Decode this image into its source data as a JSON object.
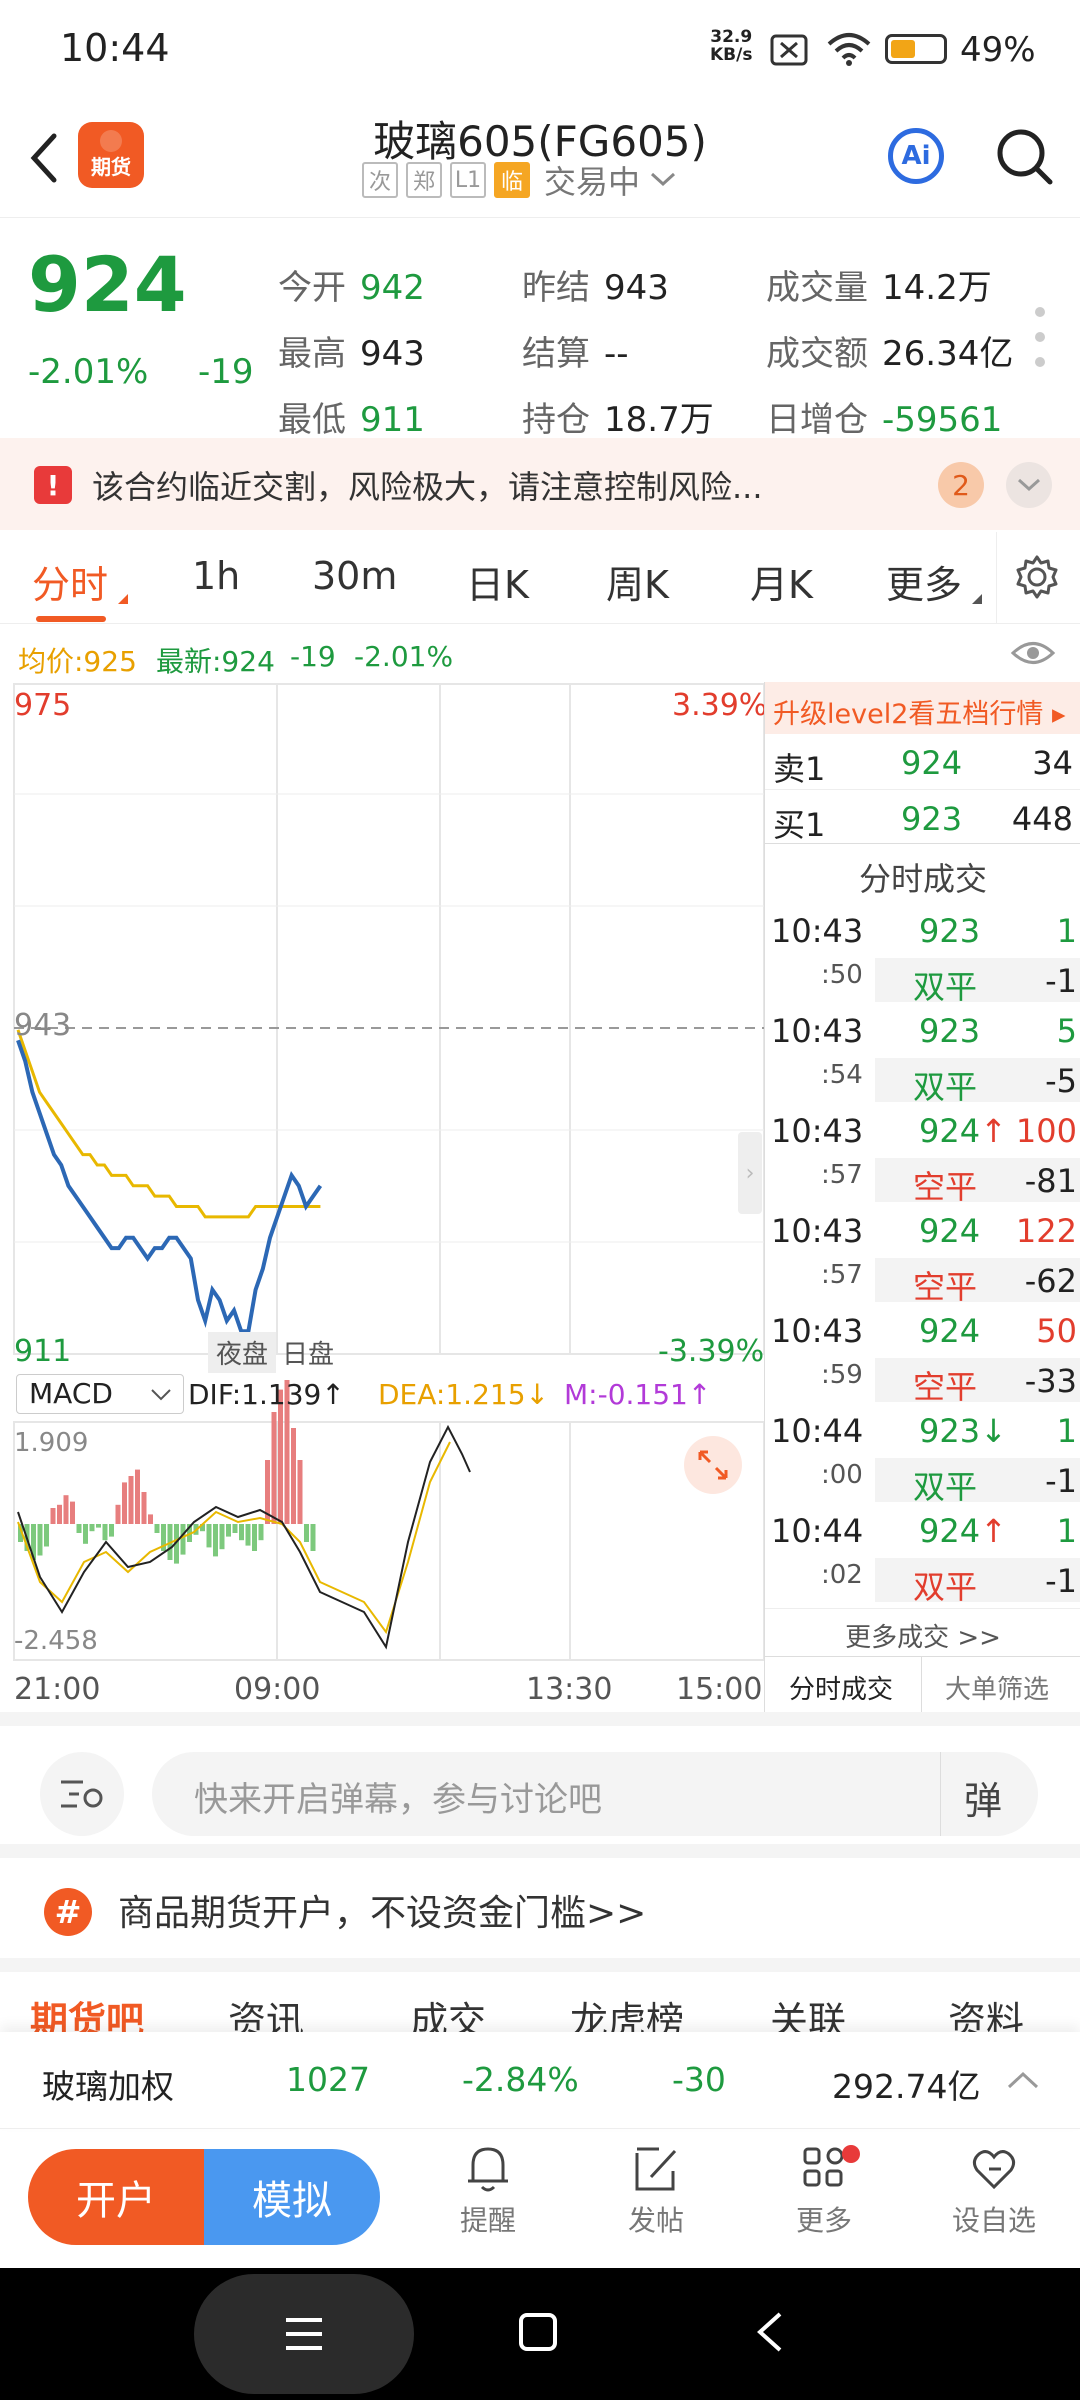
{
  "status": {
    "time": "10:44",
    "net_speed": "32.9",
    "net_unit": "KB/s",
    "battery": "49%"
  },
  "header": {
    "title": "玻璃605(FG605)",
    "logo_text": "期货",
    "tags": [
      "次",
      "郑",
      "L1",
      "临"
    ],
    "trading_status": "交易中",
    "ai_label": "Ai"
  },
  "quote": {
    "price": "924",
    "change_pct": "-2.01%",
    "change": "-19",
    "fields": [
      {
        "k": "今开",
        "v": "942",
        "color": "green"
      },
      {
        "k": "昨结",
        "v": "943",
        "color": "dark"
      },
      {
        "k": "成交量",
        "v": "14.2万",
        "color": "dark"
      },
      {
        "k": "最高",
        "v": "943",
        "color": "dark"
      },
      {
        "k": "结算",
        "v": "--",
        "color": "dark"
      },
      {
        "k": "成交额",
        "v": "26.34亿",
        "color": "dark"
      },
      {
        "k": "最低",
        "v": "911",
        "color": "green"
      },
      {
        "k": "持仓",
        "v": "18.7万",
        "color": "dark"
      },
      {
        "k": "日增仓",
        "v": "-59561",
        "color": "green"
      }
    ]
  },
  "alert": {
    "text": "该合约临近交割，风险极大，请注意控制风险...",
    "count": "2"
  },
  "tabs": [
    "分时",
    "1h",
    "30m",
    "日K",
    "周K",
    "月K",
    "更多"
  ],
  "info": {
    "avg": "均价:925",
    "latest": "最新:924",
    "change": "-19",
    "change_pct": "-2.01%"
  },
  "chart": {
    "y_top": "975",
    "y_bottom": "911",
    "pct_top": "3.39%",
    "pct_bottom": "-3.39%",
    "ref_line": "943",
    "session_labels": [
      "夜盘",
      "日盘"
    ],
    "x_labels": [
      "21:00",
      "09:00",
      "13:30",
      "15:00"
    ],
    "macd": {
      "name": "MACD",
      "dif": "DIF:1.139",
      "dea": "DEA:1.215",
      "m": "M:-0.151",
      "top": "1.909",
      "bottom": "-2.458"
    }
  },
  "chart_data": {
    "type": "line",
    "ylim": [
      911,
      975
    ],
    "reference": 943,
    "series": [
      {
        "values": [
          941,
          939,
          936,
          934,
          932,
          930,
          929,
          927,
          926,
          925,
          924,
          923,
          922,
          921,
          921,
          922,
          922,
          921,
          920,
          921,
          921,
          922,
          922,
          921,
          920,
          916,
          914,
          917,
          916,
          914,
          915,
          913,
          913,
          917,
          919,
          922,
          924,
          926,
          928,
          927,
          925,
          926,
          927
        ]
      },
      {
        "values": [
          942,
          940,
          938,
          936,
          935,
          934,
          933,
          932,
          931,
          930,
          930,
          929,
          929,
          928,
          928,
          928,
          927,
          927,
          927,
          926,
          926,
          926,
          925,
          925,
          925,
          925,
          924,
          924,
          924,
          924,
          924,
          924,
          924,
          925,
          925,
          925,
          925,
          925,
          925,
          925,
          925,
          925,
          925
        ]
      }
    ]
  },
  "order_book": {
    "upgrade": "升级level2看五档行情",
    "sell_label": "卖1",
    "sell_price": "924",
    "sell_vol": "34",
    "buy_label": "买1",
    "buy_price": "923",
    "buy_vol": "448"
  },
  "trades_title": "分时成交",
  "trades": [
    {
      "time": "10:43",
      "sec": ":50",
      "price": "923",
      "arrow": "",
      "vol": "1",
      "type": "双平",
      "oi": "-1",
      "pc": "green",
      "vc": "green",
      "tc": "green"
    },
    {
      "time": "10:43",
      "sec": ":54",
      "price": "923",
      "arrow": "",
      "vol": "5",
      "type": "双平",
      "oi": "-5",
      "pc": "green",
      "vc": "green",
      "tc": "green"
    },
    {
      "time": "10:43",
      "sec": ":57",
      "price": "924",
      "arrow": "↑",
      "vol": "100",
      "type": "空平",
      "oi": "-81",
      "pc": "green",
      "vc": "red",
      "tc": "red"
    },
    {
      "time": "10:43",
      "sec": ":57",
      "price": "924",
      "arrow": "",
      "vol": "122",
      "type": "空平",
      "oi": "-62",
      "pc": "green",
      "vc": "red",
      "tc": "red"
    },
    {
      "time": "10:43",
      "sec": ":59",
      "price": "924",
      "arrow": "",
      "vol": "50",
      "type": "空平",
      "oi": "-33",
      "pc": "green",
      "vc": "red",
      "tc": "red"
    },
    {
      "time": "10:44",
      "sec": ":00",
      "price": "923",
      "arrow": "↓",
      "vol": "1",
      "type": "双平",
      "oi": "-1",
      "pc": "green",
      "vc": "green",
      "tc": "green"
    },
    {
      "time": "10:44",
      "sec": ":02",
      "price": "924",
      "arrow": "↑",
      "vol": "1",
      "type": "双平",
      "oi": "-1",
      "pc": "green",
      "vc": "green",
      "tc": "red"
    }
  ],
  "more_trades": "更多成交 >>",
  "panel_tabs": [
    "分时成交",
    "大单筛选"
  ],
  "comment": {
    "placeholder": "快来开启弹幕，参与讨论吧",
    "danmu": "弹"
  },
  "promo": {
    "text": "商品期货开户，不设资金门槛>>"
  },
  "subtabs": [
    "期货吧",
    "资讯",
    "成交",
    "龙虎榜",
    "关联",
    "资料"
  ],
  "related": {
    "name": "玻璃加权",
    "price": "1027",
    "pct": "-2.84%",
    "change": "-30",
    "amount": "292.74亿"
  },
  "bottom": {
    "open": "开户",
    "sim": "模拟",
    "items": [
      "提醒",
      "发帖",
      "更多",
      "设自选"
    ]
  }
}
